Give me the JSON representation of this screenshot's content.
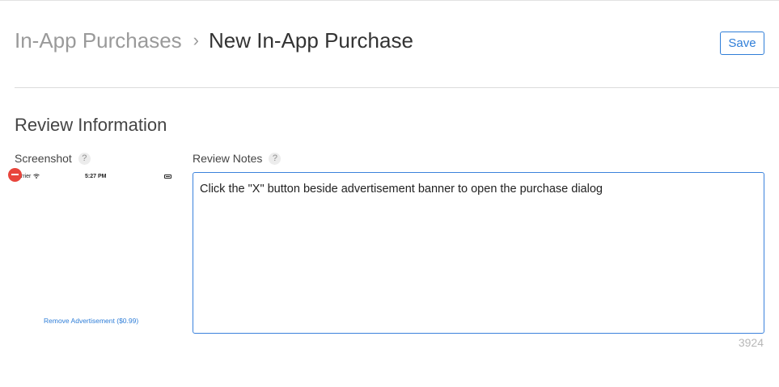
{
  "header": {
    "breadcrumb_parent": "In-App Purchases",
    "breadcrumb_separator": "›",
    "breadcrumb_current": "New In-App Purchase",
    "save_label": "Save"
  },
  "section": {
    "title": "Review Information"
  },
  "screenshot": {
    "label": "Screenshot",
    "help": "?",
    "status_carrier": "arrier",
    "status_wifi_icon": "wifi-icon",
    "status_time": "5:27 PM",
    "remove_ad_label": "Remove Advertisement ($0.99)"
  },
  "review_notes": {
    "label": "Review Notes",
    "help": "?",
    "value": "Click the \"X\" button beside advertisement banner to open the purchase dialog",
    "char_counter": "3924"
  },
  "colors": {
    "accent": "#2f7ed8",
    "delete_badge": "#e8453c"
  }
}
